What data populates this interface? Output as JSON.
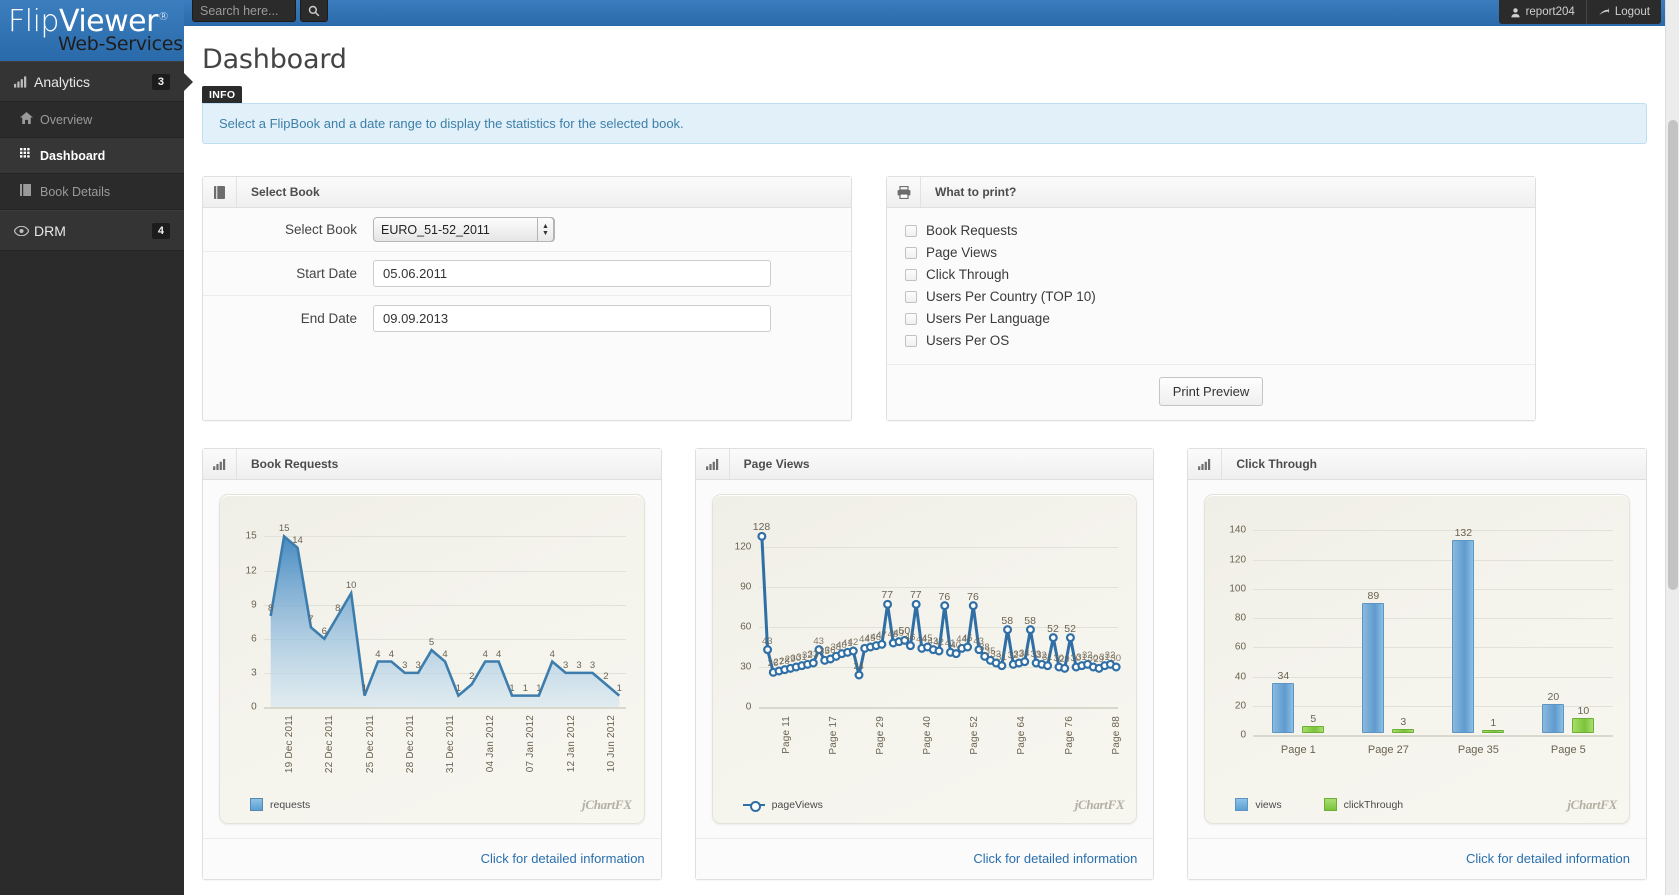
{
  "topbar": {
    "search_placeholder": "Search here...",
    "search_icon": "search-icon",
    "user_name": "report204",
    "logout_label": "Logout"
  },
  "brand": {
    "line1_a": "Flip",
    "line1_b": "Viewer",
    "registered": "®",
    "line2": "Web-Services"
  },
  "sidebar": {
    "groups": [
      {
        "label": "Analytics",
        "icon": "bar-chart-icon",
        "badge": "3",
        "items": [
          {
            "label": "Overview",
            "icon": "home-icon",
            "active": false
          },
          {
            "label": "Dashboard",
            "icon": "grid-icon",
            "active": true
          },
          {
            "label": "Book Details",
            "icon": "book-icon",
            "active": false
          }
        ]
      },
      {
        "label": "DRM",
        "icon": "eye-icon",
        "badge": "4",
        "items": []
      }
    ]
  },
  "page": {
    "title": "Dashboard",
    "info_tag": "INFO",
    "info_text": "Select a FlipBook and a date range to display the statistics for the selected book."
  },
  "select_book_panel": {
    "icon": "book-icon",
    "title": "Select Book",
    "rows": [
      {
        "label": "Select Book",
        "type": "select",
        "value": "EURO_51-52_2011"
      },
      {
        "label": "Start Date",
        "type": "text",
        "value": "05.06.2011"
      },
      {
        "label": "End Date",
        "type": "text",
        "value": "09.09.2013"
      }
    ]
  },
  "print_panel": {
    "icon": "printer-icon",
    "title": "What to print?",
    "options": [
      {
        "label": "Book Requests",
        "checked": false
      },
      {
        "label": "Page Views",
        "checked": false
      },
      {
        "label": "Click Through",
        "checked": false
      },
      {
        "label": "Users Per Country (TOP 10)",
        "checked": false
      },
      {
        "label": "Users Per Language",
        "checked": false
      },
      {
        "label": "Users Per OS",
        "checked": false
      }
    ],
    "button_label": "Print Preview"
  },
  "charts": {
    "detail_link_label": "Click for detailed information",
    "watermark": "jChartFX",
    "panel1_title": "Book Requests",
    "panel2_title": "Page Views",
    "panel3_title": "Click Through"
  },
  "chart_data": [
    {
      "type": "area",
      "title": "Book Requests",
      "xlabel": "",
      "ylabel": "",
      "ylim": [
        0,
        16
      ],
      "yticks": [
        0,
        3,
        6,
        9,
        12,
        15
      ],
      "grid": true,
      "legend": [
        "requests"
      ],
      "legend_position": "bottom-left",
      "series_color": "#3d7dad",
      "tick_labels": [
        "19 Dec 2011",
        "22 Dec 2011",
        "25 Dec 2011",
        "28 Dec 2011",
        "31 Dec 2011",
        "04 Jan 2012",
        "07 Jan 2012",
        "12 Jan 2012",
        "10 Jun 2012"
      ],
      "series": [
        {
          "name": "requests",
          "values": [
            8,
            15,
            14,
            7,
            6,
            8,
            10,
            1,
            4,
            4,
            3,
            3,
            5,
            4,
            1,
            2,
            4,
            4,
            1,
            1,
            1,
            4,
            3,
            3,
            3,
            2,
            1
          ]
        }
      ]
    },
    {
      "type": "line",
      "title": "Page Views",
      "xlabel": "",
      "ylabel": "",
      "ylim": [
        0,
        135
      ],
      "yticks": [
        0,
        30,
        60,
        90,
        120
      ],
      "grid": true,
      "legend": [
        "pageViews"
      ],
      "legend_position": "bottom-left",
      "series_color": "#2f6fa6",
      "tick_labels": [
        "Page 11",
        "Page 17",
        "Page 29",
        "Page 40",
        "Page 52",
        "Page 64",
        "Page 76",
        "Page 88"
      ],
      "annotated_peaks": [
        128,
        43,
        43,
        77,
        77,
        76,
        76,
        58,
        58,
        52,
        52,
        24
      ],
      "series": [
        {
          "name": "pageViews",
          "values": [
            128,
            43,
            26,
            27,
            28,
            29,
            30,
            31,
            32,
            33,
            43,
            35,
            36,
            38,
            40,
            41,
            42,
            24,
            44,
            45,
            46,
            47,
            77,
            48,
            49,
            50,
            46,
            77,
            44,
            45,
            43,
            42,
            76,
            41,
            40,
            44,
            45,
            76,
            43,
            38,
            35,
            33,
            31,
            58,
            32,
            33,
            34,
            58,
            33,
            32,
            31,
            52,
            30,
            29,
            52,
            30,
            31,
            32,
            30,
            29,
            31,
            32,
            30
          ]
        }
      ]
    },
    {
      "type": "bar",
      "title": "Click Through",
      "xlabel": "",
      "ylabel": "",
      "ylim": [
        0,
        145
      ],
      "yticks": [
        0,
        20,
        40,
        60,
        80,
        100,
        120,
        140
      ],
      "grid": true,
      "legend": [
        "views",
        "clickThrough"
      ],
      "legend_position": "bottom-left",
      "categories": [
        "Page 1",
        "Page 27",
        "Page 35",
        "Page 5"
      ],
      "series": [
        {
          "name": "views",
          "color": "#6fa7d5",
          "values": [
            34,
            89,
            132,
            20
          ]
        },
        {
          "name": "clickThrough",
          "color": "#8ccf49",
          "values": [
            5,
            3,
            1,
            10
          ]
        }
      ]
    }
  ]
}
